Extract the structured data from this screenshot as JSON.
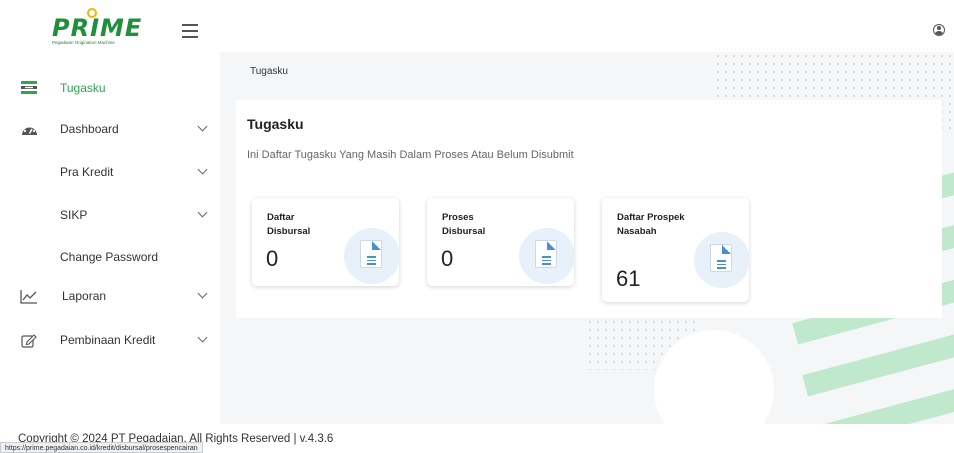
{
  "app": {
    "logo_text": "PRIME",
    "logo_tagline": "Pegadaian Origination Machine"
  },
  "sidebar": {
    "items": [
      {
        "label": "Tugasku",
        "icon": "task-list-icon",
        "active": true,
        "has_chevron": false
      },
      {
        "label": "Dashboard",
        "icon": "dashboard-gauge-icon",
        "active": false,
        "has_chevron": true
      },
      {
        "label": "Pra Kredit",
        "icon": "",
        "active": false,
        "has_chevron": true
      },
      {
        "label": "SIKP",
        "icon": "",
        "active": false,
        "has_chevron": true
      },
      {
        "label": "Change Password",
        "icon": "",
        "active": false,
        "has_chevron": false
      },
      {
        "label": "Laporan",
        "icon": "line-chart-icon",
        "active": false,
        "has_chevron": true
      },
      {
        "label": "Pembinaan Kredit",
        "icon": "edit-icon",
        "active": false,
        "has_chevron": true
      }
    ]
  },
  "breadcrumb": "Tugasku",
  "main": {
    "title": "Tugasku",
    "subtitle": "Ini Daftar Tugasku Yang Masih Dalam Proses Atau Belum Disubmit",
    "cards": [
      {
        "title": "Daftar Disbursal",
        "value": "0",
        "icon": "document-icon"
      },
      {
        "title": "Proses Disbursal",
        "value": "0",
        "icon": "document-icon"
      },
      {
        "title": "Daftar Prospek Nasabah",
        "value": "61",
        "icon": "document-icon"
      }
    ]
  },
  "footer": {
    "copyright": "Copyright © 2024 PT Pegadaian. All Rights Reserved | v.4.3.6"
  },
  "status_bar": {
    "url": "https://prime.pegadaian.co.id/kredit/disbursal/prosespencairan"
  },
  "colors": {
    "accent_green": "#2aa84a",
    "logo_green": "#1f8f3a",
    "logo_sun": "#f4b400",
    "doc_blue": "#4a90d0",
    "stripe_green": "#bfe8cc",
    "content_bg": "#f5f6f8"
  }
}
